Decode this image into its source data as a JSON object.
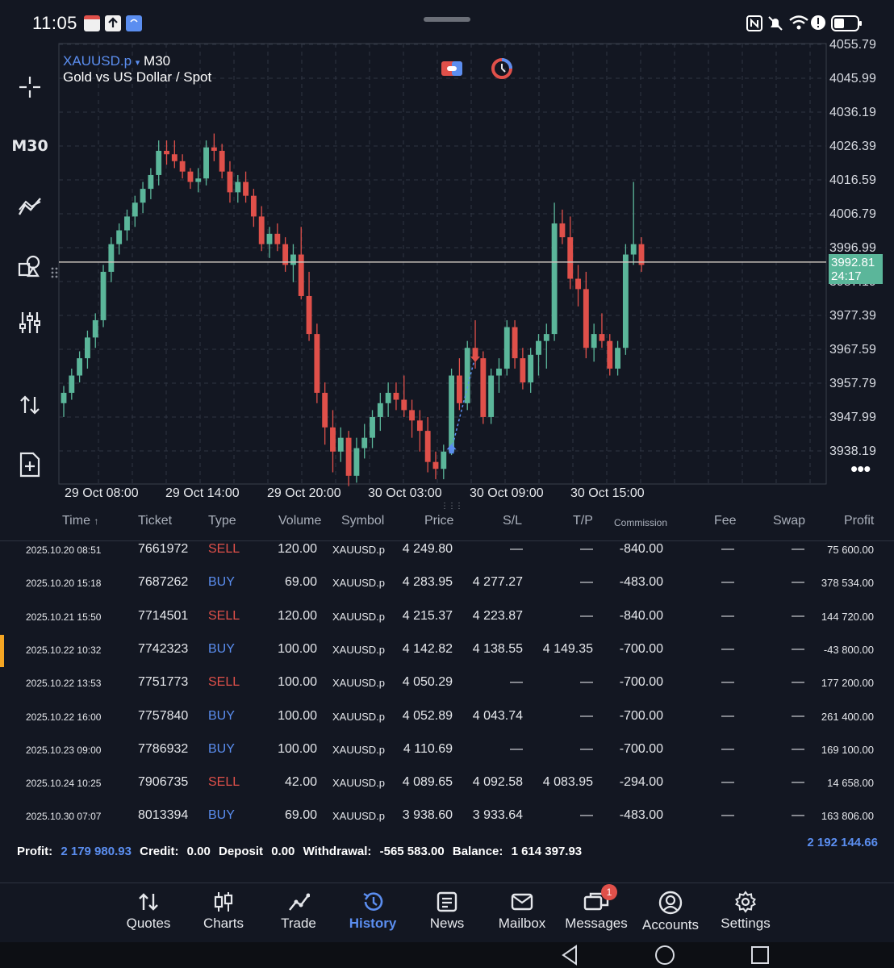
{
  "status_bar": {
    "time": "11:05"
  },
  "toolbar": {
    "timeframe": "M30"
  },
  "chart": {
    "symbol": "XAUUSD.p",
    "timeframe": "M30",
    "description": "Gold vs US Dollar / Spot",
    "current_price": "3992.81",
    "countdown": "24:17",
    "price_labels": [
      "4055.79",
      "4045.99",
      "4036.19",
      "4026.39",
      "4016.59",
      "4006.79",
      "3996.99",
      "3987.19",
      "3977.39",
      "3967.59",
      "3957.79",
      "3947.99",
      "3938.19"
    ],
    "time_labels": [
      "29 Oct 08:00",
      "29 Oct 14:00",
      "29 Oct 20:00",
      "30 Oct 03:00",
      "30 Oct 09:00",
      "30 Oct 15:00"
    ]
  },
  "chart_data": {
    "type": "candlestick",
    "symbol": "XAUUSD.p",
    "timeframe": "M30",
    "ylim": [
      3930.0,
      4058.0
    ],
    "candles": [
      [
        3952,
        3957,
        3948,
        3955
      ],
      [
        3955,
        3962,
        3953,
        3960
      ],
      [
        3960,
        3967,
        3958,
        3965
      ],
      [
        3965,
        3973,
        3962,
        3971
      ],
      [
        3971,
        3978,
        3968,
        3976
      ],
      [
        3976,
        3992,
        3974,
        3990
      ],
      [
        3990,
        4000,
        3987,
        3998
      ],
      [
        3998,
        4004,
        3995,
        4002
      ],
      [
        4002,
        4008,
        3999,
        4006
      ],
      [
        4006,
        4012,
        4003,
        4010
      ],
      [
        4010,
        4016,
        4007,
        4014
      ],
      [
        4014,
        4020,
        4011,
        4018
      ],
      [
        4018,
        4028,
        4015,
        4025
      ],
      [
        4025,
        4028,
        4021,
        4024
      ],
      [
        4024,
        4028,
        4020,
        4022
      ],
      [
        4022,
        4024,
        4017,
        4019
      ],
      [
        4019,
        4020,
        4014,
        4016
      ],
      [
        4016,
        4020,
        4013,
        4017
      ],
      [
        4017,
        4028,
        4015,
        4026
      ],
      [
        4026,
        4030,
        4022,
        4025
      ],
      [
        4025,
        4027,
        4017,
        4019
      ],
      [
        4019,
        4022,
        4010,
        4013
      ],
      [
        4013,
        4018,
        4010,
        4016
      ],
      [
        4016,
        4019,
        4010,
        4012
      ],
      [
        4012,
        4014,
        4003,
        4006
      ],
      [
        4006,
        4009,
        3996,
        3998
      ],
      [
        3998,
        4003,
        3994,
        4001
      ],
      [
        4001,
        4004,
        3996,
        3998
      ],
      [
        3998,
        4000,
        3990,
        3992
      ],
      [
        3992,
        3998,
        3987,
        3995
      ],
      [
        3995,
        4003,
        3982,
        3983
      ],
      [
        3983,
        3990,
        3970,
        3972
      ],
      [
        3972,
        3975,
        3952,
        3955
      ],
      [
        3955,
        3958,
        3940,
        3945
      ],
      [
        3945,
        3950,
        3932,
        3938
      ],
      [
        3938,
        3945,
        3935,
        3942
      ],
      [
        3942,
        3944,
        3928,
        3931
      ],
      [
        3931,
        3942,
        3929,
        3939
      ],
      [
        3939,
        3946,
        3936,
        3942
      ],
      [
        3942,
        3950,
        3939,
        3948
      ],
      [
        3948,
        3955,
        3944,
        3952
      ],
      [
        3952,
        3958,
        3948,
        3955
      ],
      [
        3955,
        3958,
        3950,
        3953
      ],
      [
        3953,
        3960,
        3948,
        3950
      ],
      [
        3950,
        3953,
        3942,
        3947
      ],
      [
        3947,
        3950,
        3938,
        3944
      ],
      [
        3944,
        3948,
        3932,
        3935
      ],
      [
        3935,
        3938,
        3930,
        3933
      ],
      [
        3933,
        3940,
        3930,
        3938
      ],
      [
        3938,
        3962,
        3937,
        3960
      ],
      [
        3960,
        3965,
        3950,
        3952
      ],
      [
        3952,
        3970,
        3950,
        3968
      ],
      [
        3968,
        3976,
        3962,
        3965
      ],
      [
        3965,
        3967,
        3946,
        3948
      ],
      [
        3948,
        3962,
        3946,
        3960
      ],
      [
        3960,
        3965,
        3955,
        3962
      ],
      [
        3962,
        3976,
        3960,
        3974
      ],
      [
        3974,
        3976,
        3962,
        3965
      ],
      [
        3965,
        3968,
        3956,
        3958
      ],
      [
        3958,
        3968,
        3955,
        3966
      ],
      [
        3966,
        3972,
        3960,
        3970
      ],
      [
        3970,
        3975,
        3962,
        3972
      ],
      [
        3972,
        4010,
        3970,
        4004
      ],
      [
        4004,
        4008,
        3998,
        4000
      ],
      [
        4000,
        4006,
        3985,
        3988
      ],
      [
        3988,
        3992,
        3980,
        3985
      ],
      [
        3985,
        3990,
        3965,
        3968
      ],
      [
        3968,
        3975,
        3964,
        3972
      ],
      [
        3972,
        3978,
        3968,
        3970
      ],
      [
        3970,
        3972,
        3960,
        3962
      ],
      [
        3962,
        3970,
        3960,
        3968
      ],
      [
        3968,
        3998,
        3966,
        3995
      ],
      [
        3995,
        4016,
        3992,
        3998
      ],
      [
        3998,
        4000,
        3990,
        3992
      ]
    ],
    "current_price": 3992.81,
    "marks": [
      {
        "type": "buy",
        "price": 3938.6
      },
      {
        "type": "sell",
        "price": 3965.5
      }
    ]
  },
  "table": {
    "headers": {
      "time": "Time",
      "ticket": "Ticket",
      "type": "Type",
      "volume": "Volume",
      "symbol": "Symbol",
      "price": "Price",
      "sl": "S/L",
      "tp": "T/P",
      "commission": "Commission",
      "fee": "Fee",
      "swap": "Swap",
      "profit": "Profit"
    },
    "rows": [
      {
        "time": "2025.10.20 08:51",
        "ticket": "7661972",
        "type": "SELL",
        "volume": "120.00",
        "symbol": "XAUUSD.p",
        "price": "4 249.80",
        "sl": "—",
        "tp": "—",
        "commission": "-840.00",
        "fee": "—",
        "swap": "—",
        "profit": "75 600.00"
      },
      {
        "time": "2025.10.20 15:18",
        "ticket": "7687262",
        "type": "BUY",
        "volume": "69.00",
        "symbol": "XAUUSD.p",
        "price": "4 283.95",
        "sl": "4 277.27",
        "tp": "—",
        "commission": "-483.00",
        "fee": "—",
        "swap": "—",
        "profit": "378 534.00"
      },
      {
        "time": "2025.10.21 15:50",
        "ticket": "7714501",
        "type": "SELL",
        "volume": "120.00",
        "symbol": "XAUUSD.p",
        "price": "4 215.37",
        "sl": "4 223.87",
        "tp": "—",
        "commission": "-840.00",
        "fee": "—",
        "swap": "—",
        "profit": "144 720.00"
      },
      {
        "time": "2025.10.22 10:32",
        "ticket": "7742323",
        "type": "BUY",
        "volume": "100.00",
        "symbol": "XAUUSD.p",
        "price": "4 142.82",
        "sl": "4 138.55",
        "tp": "4 149.35",
        "commission": "-700.00",
        "fee": "—",
        "swap": "—",
        "profit": "-43 800.00"
      },
      {
        "time": "2025.10.22 13:53",
        "ticket": "7751773",
        "type": "SELL",
        "volume": "100.00",
        "symbol": "XAUUSD.p",
        "price": "4 050.29",
        "sl": "—",
        "tp": "—",
        "commission": "-700.00",
        "fee": "—",
        "swap": "—",
        "profit": "177 200.00"
      },
      {
        "time": "2025.10.22 16:00",
        "ticket": "7757840",
        "type": "BUY",
        "volume": "100.00",
        "symbol": "XAUUSD.p",
        "price": "4 052.89",
        "sl": "4 043.74",
        "tp": "—",
        "commission": "-700.00",
        "fee": "—",
        "swap": "—",
        "profit": "261 400.00"
      },
      {
        "time": "2025.10.23 09:00",
        "ticket": "7786932",
        "type": "BUY",
        "volume": "100.00",
        "symbol": "XAUUSD.p",
        "price": "4 110.69",
        "sl": "—",
        "tp": "—",
        "commission": "-700.00",
        "fee": "—",
        "swap": "—",
        "profit": "169 100.00"
      },
      {
        "time": "2025.10.24 10:25",
        "ticket": "7906735",
        "type": "SELL",
        "volume": "42.00",
        "symbol": "XAUUSD.p",
        "price": "4 089.65",
        "sl": "4 092.58",
        "tp": "4 083.95",
        "commission": "-294.00",
        "fee": "—",
        "swap": "—",
        "profit": "14 658.00"
      },
      {
        "time": "2025.10.30 07:07",
        "ticket": "8013394",
        "type": "BUY",
        "volume": "69.00",
        "symbol": "XAUUSD.p",
        "price": "3 938.60",
        "sl": "3 933.64",
        "tp": "—",
        "commission": "-483.00",
        "fee": "—",
        "swap": "—",
        "profit": "163 806.00"
      }
    ]
  },
  "summary": {
    "profit_label": "Profit:",
    "profit": "2 179 980.93",
    "credit_label": "Credit:",
    "credit": "0.00",
    "deposit_label": "Deposit",
    "deposit": "0.00",
    "withdrawal_label": "Withdrawal:",
    "withdrawal": "-565 583.00",
    "balance_label": "Balance:",
    "balance": "1 614 397.93",
    "total": "2 192 144.66"
  },
  "nav": {
    "items": [
      "Quotes",
      "Charts",
      "Trade",
      "History",
      "News",
      "Mailbox",
      "Messages",
      "Accounts",
      "Settings"
    ],
    "active": "History",
    "messages_badge": "1"
  },
  "colors": {
    "bull": "#5bb69a",
    "bear": "#e0504a",
    "accent": "#5b8ef0",
    "background": "#131722"
  }
}
